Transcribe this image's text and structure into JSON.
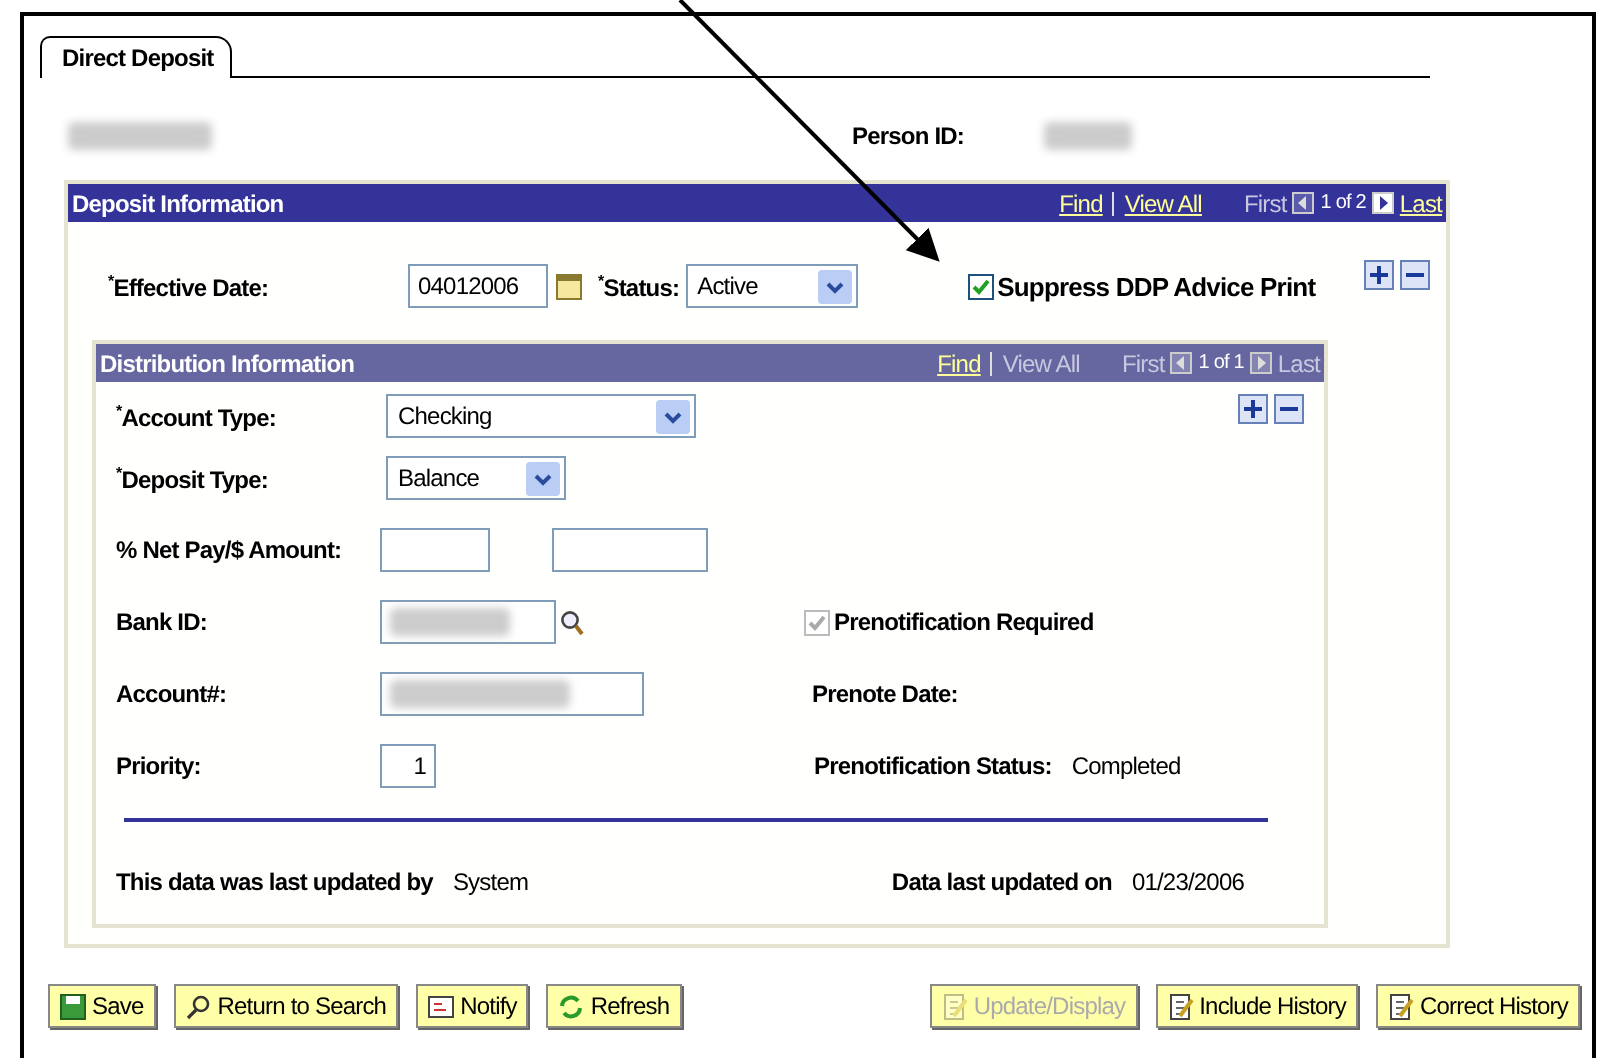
{
  "tab": {
    "label": "Direct Deposit",
    "selected": true
  },
  "person_id": {
    "label": "Person ID:"
  },
  "deposit_panel": {
    "title": "Deposit Information",
    "nav": {
      "find": "Find",
      "view_all": "View All",
      "view_all_disabled": false,
      "first": "First",
      "position": "1 of 2",
      "last": "Last",
      "first_disabled": true,
      "last_disabled": false
    },
    "effective_date": {
      "label": "$^{*}$Effective Date:",
      "value": "04012006"
    },
    "status": {
      "label": "$^{*}$Status:",
      "value": "Active"
    },
    "suppress": {
      "label": "Suppress DDP Advice Print",
      "checked": true
    }
  },
  "distribution_panel": {
    "title": "Distribution Information",
    "nav": {
      "find": "Find",
      "view_all": "View All",
      "view_all_disabled": true,
      "first": "First",
      "position": "1 of 1",
      "last": "Last",
      "first_disabled": true,
      "last_disabled": true
    },
    "account_type": {
      "label": "$^{*}$Account Type:",
      "value": "Checking"
    },
    "deposit_type": {
      "label": "$^{*}$Deposit Type:",
      "value": "Balance"
    },
    "amount": {
      "label": "% Net Pay/$ Amount:"
    },
    "bank_id": {
      "label": "Bank ID:"
    },
    "account": {
      "label": "Account#:"
    },
    "priority": {
      "label": "Priority:",
      "value": "1"
    },
    "prenote_required": {
      "label": "Prenotification Required",
      "checked": true,
      "disabled": true
    },
    "prenote_date": {
      "label": "Prenote Date:"
    },
    "prenote_status": {
      "label": "Prenotification Status:",
      "value": "Completed"
    }
  },
  "last_updated_by": {
    "label": "This data was last updated by",
    "value": "System"
  },
  "last_updated_on": {
    "label": "Data last updated on",
    "value": "01/23/2006"
  },
  "buttons": [
    {
      "label": "Save",
      "disabled": false
    },
    {
      "label": "Return to Search",
      "disabled": false
    },
    {
      "label": "Notify",
      "disabled": false
    },
    {
      "label": "Refresh",
      "disabled": false
    },
    {
      "label": "Update/Display",
      "disabled": true
    },
    {
      "label": "Include History",
      "disabled": false
    },
    {
      "label": "Correct History",
      "disabled": false
    }
  ]
}
